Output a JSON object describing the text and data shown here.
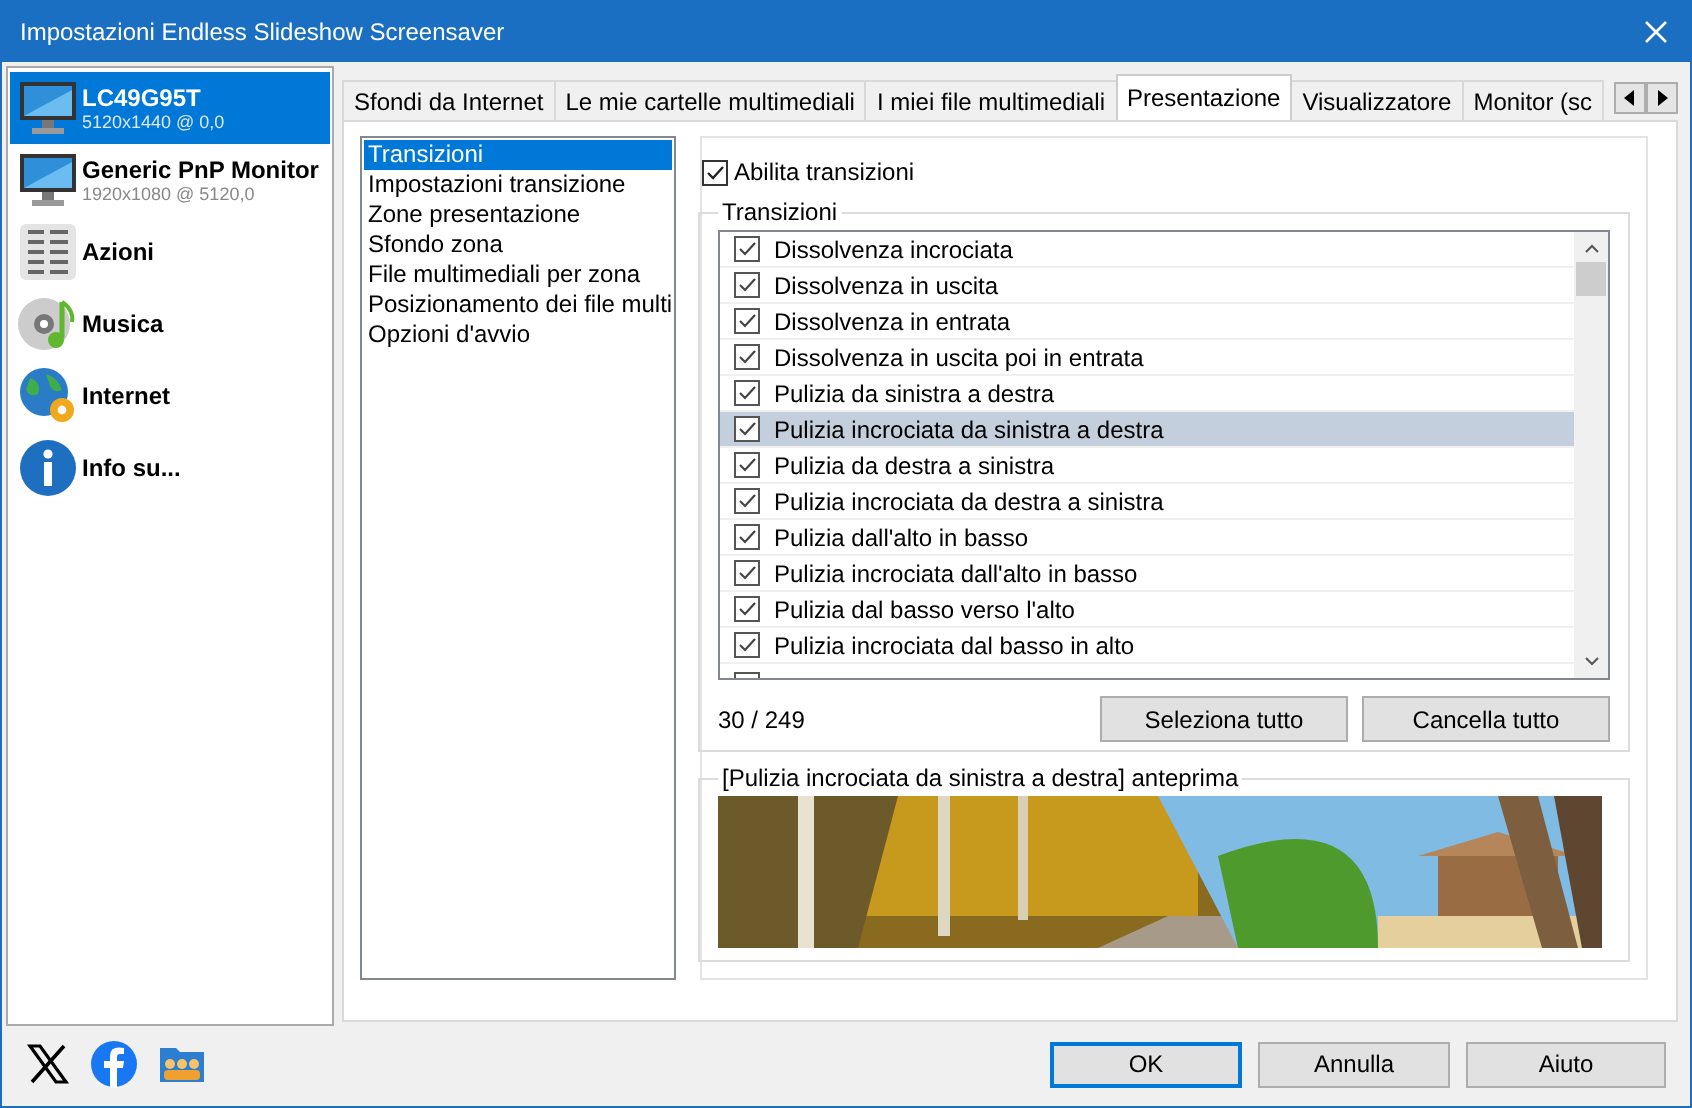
{
  "window": {
    "title": "Impostazioni Endless Slideshow Screensaver"
  },
  "sidebar": {
    "items": [
      {
        "kind": "monitor",
        "title": "LC49G95T",
        "subtitle": "5120x1440 @ 0,0",
        "selected": true
      },
      {
        "kind": "monitor",
        "title": "Generic PnP Monitor",
        "subtitle": "1920x1080 @ 5120,0",
        "selected": false
      },
      {
        "kind": "actions",
        "title": "Azioni",
        "selected": false
      },
      {
        "kind": "music",
        "title": "Musica",
        "selected": false
      },
      {
        "kind": "internet",
        "title": "Internet",
        "selected": false
      },
      {
        "kind": "info",
        "title": "Info su...",
        "selected": false
      }
    ]
  },
  "tabs": [
    {
      "label": "Sfondi da Internet",
      "selected": false
    },
    {
      "label": "Le mie cartelle multimediali",
      "selected": false
    },
    {
      "label": "I miei file multimediali",
      "selected": false
    },
    {
      "label": "Presentazione",
      "selected": true
    },
    {
      "label": "Visualizzatore",
      "selected": false
    },
    {
      "label": "Monitor (sc",
      "selected": false
    }
  ],
  "sections": [
    {
      "label": "Transizioni",
      "selected": true
    },
    {
      "label": "Impostazioni transizione",
      "selected": false
    },
    {
      "label": "Zone presentazione",
      "selected": false
    },
    {
      "label": "Sfondo zona",
      "selected": false
    },
    {
      "label": "File multimediali per zona",
      "selected": false
    },
    {
      "label": "Posizionamento dei file multi",
      "selected": false
    },
    {
      "label": "Opzioni d'avvio",
      "selected": false
    }
  ],
  "enable_transitions": {
    "label": "Abilita transizioni",
    "checked": true
  },
  "transitions": {
    "title": "Transizioni",
    "items": [
      {
        "label": "Dissolvenza incrociata",
        "checked": true,
        "selected": false
      },
      {
        "label": "Dissolvenza in uscita",
        "checked": true,
        "selected": false
      },
      {
        "label": "Dissolvenza in entrata",
        "checked": true,
        "selected": false
      },
      {
        "label": "Dissolvenza in uscita poi in entrata",
        "checked": true,
        "selected": false
      },
      {
        "label": "Pulizia da sinistra a destra",
        "checked": true,
        "selected": false
      },
      {
        "label": "Pulizia incrociata da sinistra a destra",
        "checked": true,
        "selected": true
      },
      {
        "label": "Pulizia da destra a sinistra",
        "checked": true,
        "selected": false
      },
      {
        "label": "Pulizia incrociata da destra a sinistra",
        "checked": true,
        "selected": false
      },
      {
        "label": "Pulizia dall'alto in basso",
        "checked": true,
        "selected": false
      },
      {
        "label": "Pulizia incrociata dall'alto in basso",
        "checked": true,
        "selected": false
      },
      {
        "label": "Pulizia dal basso verso l'alto",
        "checked": true,
        "selected": false
      },
      {
        "label": "Pulizia incrociata dal basso in alto",
        "checked": true,
        "selected": false
      }
    ],
    "count": "30 / 249",
    "buttons": [
      "Seleziona tutto",
      "Cancella tutto"
    ]
  },
  "preview": {
    "title": "[Pulizia incrociata da sinistra a destra] anteprima",
    "kind": "picture"
  },
  "footer_buttons": [
    {
      "label": "OK",
      "default": true
    },
    {
      "label": "Annulla",
      "default": false
    },
    {
      "label": "Aiuto",
      "default": false
    }
  ]
}
